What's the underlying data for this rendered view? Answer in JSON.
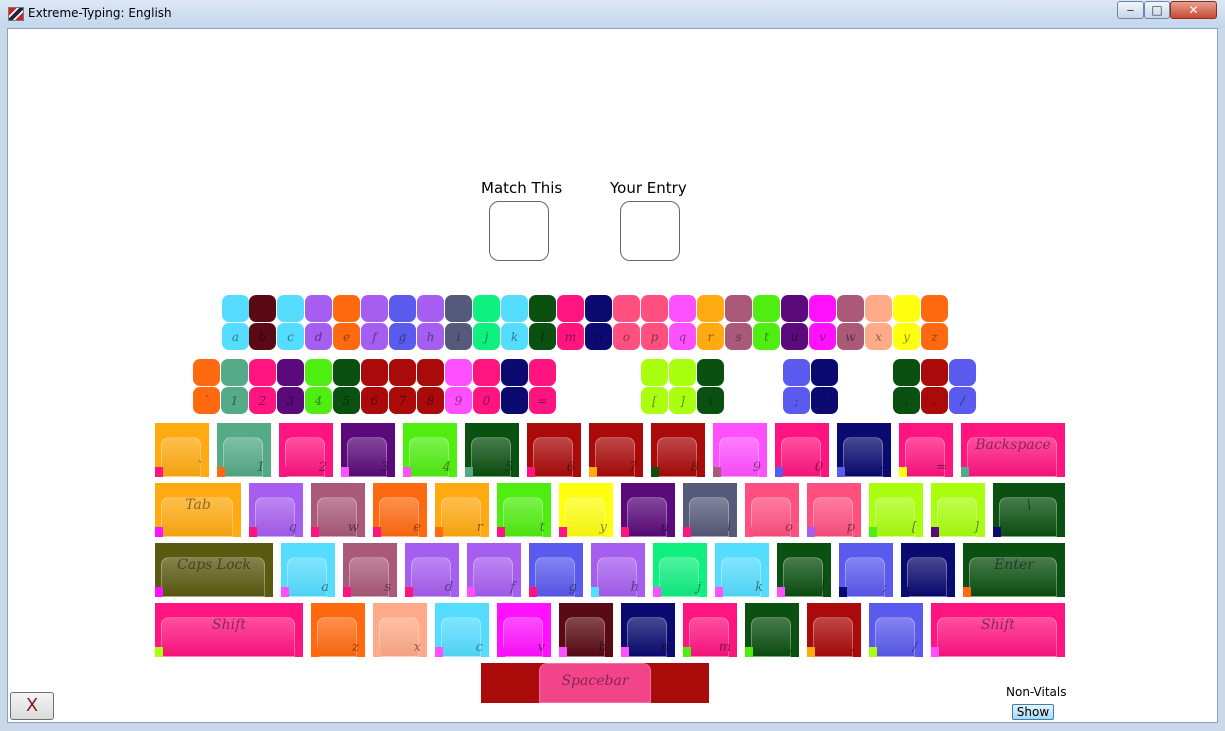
{
  "window": {
    "title": "Extreme-Typing: English",
    "minimize": "‒",
    "maximize": "□",
    "close": "✕"
  },
  "prompts": {
    "match_label": "Match This",
    "entry_label": "Your Entry"
  },
  "small_rows": [
    {
      "keys": [
        {
          "top": "#55ddff",
          "bottom": "#55ddff",
          "label": "a"
        },
        {
          "top": "#5a0a14",
          "bottom": "#5a0a14",
          "label": "b"
        },
        {
          "top": "#55ddff",
          "bottom": "#55ddff",
          "label": "c"
        },
        {
          "top": "#a65ef0",
          "bottom": "#a65ef0",
          "label": "d"
        },
        {
          "top": "#ff6a10",
          "bottom": "#ff6a10",
          "label": "e"
        },
        {
          "top": "#a65ef0",
          "bottom": "#a65ef0",
          "label": "f"
        },
        {
          "top": "#5a5aee",
          "bottom": "#5a5aee",
          "label": "g"
        },
        {
          "top": "#a65ef0",
          "bottom": "#a65ef0",
          "label": "h"
        },
        {
          "top": "#555a7a",
          "bottom": "#555a7a",
          "label": "i"
        },
        {
          "top": "#10f080",
          "bottom": "#10f080",
          "label": "j"
        },
        {
          "top": "#55ddff",
          "bottom": "#55ddff",
          "label": "k"
        },
        {
          "top": "#0a5010",
          "bottom": "#0a5010",
          "label": "l"
        },
        {
          "top": "#ff1480",
          "bottom": "#ff1480",
          "label": "m"
        },
        {
          "top": "#0a0a70",
          "bottom": "#0a0a70",
          "label": "n"
        },
        {
          "top": "#ff5080",
          "bottom": "#ff5080",
          "label": "o"
        },
        {
          "top": "#ff5080",
          "bottom": "#ff5080",
          "label": "p"
        },
        {
          "top": "#ff50ff",
          "bottom": "#ff50ff",
          "label": "q"
        },
        {
          "top": "#ffaa10",
          "bottom": "#ffaa10",
          "label": "r"
        },
        {
          "top": "#aa5a78",
          "bottom": "#aa5a78",
          "label": "s"
        },
        {
          "top": "#50ee10",
          "bottom": "#50ee10",
          "label": "t"
        },
        {
          "top": "#5a0a7a",
          "bottom": "#5a0a7a",
          "label": "u"
        },
        {
          "top": "#ff10ff",
          "bottom": "#ff10ff",
          "label": "v"
        },
        {
          "top": "#aa5a78",
          "bottom": "#aa5a78",
          "label": "w"
        },
        {
          "top": "#ffaa88",
          "bottom": "#ffaa88",
          "label": "x"
        },
        {
          "top": "#ffff10",
          "bottom": "#ffff10",
          "label": "y"
        },
        {
          "top": "#ff6a10",
          "bottom": "#ff6a10",
          "label": "z"
        }
      ]
    },
    {
      "keys": [
        {
          "top": "#ff6a10",
          "bottom": "#ff6a10",
          "label": "`"
        },
        {
          "top": "#55aa88",
          "bottom": "#55aa88",
          "label": "1"
        },
        {
          "top": "#ff1480",
          "bottom": "#ff1480",
          "label": "2"
        },
        {
          "top": "#5a0a7a",
          "bottom": "#5a0a7a",
          "label": "3"
        },
        {
          "top": "#50ee10",
          "bottom": "#50ee10",
          "label": "4"
        },
        {
          "top": "#0a5010",
          "bottom": "#0a5010",
          "label": "5"
        },
        {
          "top": "#aa0a0a",
          "bottom": "#aa0a0a",
          "label": "6"
        },
        {
          "top": "#aa0a0a",
          "bottom": "#aa0a0a",
          "label": "7"
        },
        {
          "top": "#aa0a0a",
          "bottom": "#aa0a0a",
          "label": "8"
        },
        {
          "top": "#ff50ff",
          "bottom": "#ff50ff",
          "label": "9"
        },
        {
          "top": "#ff1480",
          "bottom": "#ff1480",
          "label": "0"
        },
        {
          "top": "#0a0a70",
          "bottom": "#0a0a70",
          "label": "-"
        },
        {
          "top": "#ff1480",
          "bottom": "#ff1480",
          "label": "="
        },
        {
          "top": "#aaff10",
          "bottom": "#aaff10",
          "label": "["
        },
        {
          "top": "#aaff10",
          "bottom": "#aaff10",
          "label": "]"
        },
        {
          "top": "#0a5010",
          "bottom": "#0a5010",
          "label": "\\"
        },
        {
          "top": "#5a5aee",
          "bottom": "#5a5aee",
          "label": ";"
        },
        {
          "top": "#0a0a70",
          "bottom": "#0a0a70",
          "label": "'"
        },
        {
          "top": "#0a5010",
          "bottom": "#0a5010",
          "label": ","
        },
        {
          "top": "#aa0a0a",
          "bottom": "#aa0a0a",
          "label": "."
        },
        {
          "top": "#5a5aee",
          "bottom": "#5a5aee",
          "label": "/"
        }
      ]
    }
  ],
  "keyboard": [
    [
      {
        "color": "#ffaa10",
        "acc": "#ff1480",
        "label": "`"
      },
      {
        "color": "#55aa88",
        "acc": "#ff6a10",
        "label": "1"
      },
      {
        "color": "#ff1480",
        "acc": "#ff1480",
        "label": "2"
      },
      {
        "color": "#5a0a7a",
        "acc": "#ff50ff",
        "label": "3"
      },
      {
        "color": "#50ee10",
        "acc": "#ff50ff",
        "label": "4"
      },
      {
        "color": "#0a5010",
        "acc": "#55aa88",
        "label": "5"
      },
      {
        "color": "#aa0a0a",
        "acc": "#ff1480",
        "label": "6"
      },
      {
        "color": "#aa0a0a",
        "acc": "#ffaa10",
        "label": "7"
      },
      {
        "color": "#aa0a0a",
        "acc": "#0a5010",
        "label": "8"
      },
      {
        "color": "#ff50ff",
        "acc": "#aa5a78",
        "label": "9"
      },
      {
        "color": "#ff1480",
        "acc": "#5a5aee",
        "label": "0"
      },
      {
        "color": "#0a0a70",
        "acc": "#5a5aee",
        "label": "-"
      },
      {
        "color": "#ff1480",
        "acc": "#ffff10",
        "label": "="
      },
      {
        "color": "#ff1480",
        "acc": "#55aa88",
        "label": "Backspace",
        "wide": true
      }
    ],
    [
      {
        "color": "#ffaa10",
        "acc": "#ff10ff",
        "label": "Tab",
        "wide": true
      },
      {
        "color": "#a65ef0",
        "acc": "#ff1480",
        "label": "q"
      },
      {
        "color": "#aa5a78",
        "acc": "#ff1480",
        "label": "w"
      },
      {
        "color": "#ff6a10",
        "acc": "#ff1480",
        "label": "e"
      },
      {
        "color": "#ffaa10",
        "acc": "#ff6a10",
        "label": "r"
      },
      {
        "color": "#50ee10",
        "acc": "#ff1480",
        "label": "t"
      },
      {
        "color": "#ffff10",
        "acc": "#ff1480",
        "label": "y"
      },
      {
        "color": "#5a0a7a",
        "acc": "#ff1480",
        "label": "u"
      },
      {
        "color": "#555a7a",
        "acc": "#ff1480",
        "label": "i"
      },
      {
        "color": "#ff5080",
        "acc": "#ff5080",
        "label": "o"
      },
      {
        "color": "#ff5080",
        "acc": "#a65ef0",
        "label": "p"
      },
      {
        "color": "#aaff10",
        "acc": "#50ee10",
        "label": "["
      },
      {
        "color": "#aaff10",
        "acc": "#5a0a7a",
        "label": "]"
      },
      {
        "color": "#0a5010",
        "acc": "#0a0a70",
        "label": "\\",
        "wide": true
      }
    ],
    [
      {
        "color": "#5a5a10",
        "acc": "#ff10ff",
        "label": "Caps Lock",
        "wide": true
      },
      {
        "color": "#55ddff",
        "acc": "#ff50ff",
        "label": "a"
      },
      {
        "color": "#aa5a78",
        "acc": "#ff1480",
        "label": "s"
      },
      {
        "color": "#a65ef0",
        "acc": "#ff1480",
        "label": "d"
      },
      {
        "color": "#a65ef0",
        "acc": "#ff50ff",
        "label": "f"
      },
      {
        "color": "#5a5aee",
        "acc": "#ff1480",
        "label": "g"
      },
      {
        "color": "#a65ef0",
        "acc": "#55ddff",
        "label": "h"
      },
      {
        "color": "#10f080",
        "acc": "#ff50ff",
        "label": "j"
      },
      {
        "color": "#55ddff",
        "acc": "#ff50ff",
        "label": "k"
      },
      {
        "color": "#0a5010",
        "acc": "#ff50ff",
        "label": "l"
      },
      {
        "color": "#5a5aee",
        "acc": "#0a0a70",
        "label": ";"
      },
      {
        "color": "#0a0a70",
        "acc": "#0a0a70",
        "label": "'"
      },
      {
        "color": "#0a5010",
        "acc": "#ff6a10",
        "label": "Enter",
        "wide": true
      }
    ],
    [
      {
        "color": "#ff1480",
        "acc": "#aaff10",
        "label": "Shift",
        "wide": true
      },
      {
        "color": "#ff6a10",
        "acc": "#ff6a10",
        "label": "z"
      },
      {
        "color": "#ffaa88",
        "acc": "#ffaa88",
        "label": "x"
      },
      {
        "color": "#55ddff",
        "acc": "#ff50ff",
        "label": "c"
      },
      {
        "color": "#ff10ff",
        "acc": "#ff10ff",
        "label": "v"
      },
      {
        "color": "#5a0a14",
        "acc": "#ff50ff",
        "label": "b"
      },
      {
        "color": "#0a0a70",
        "acc": "#ff50ff",
        "label": "n"
      },
      {
        "color": "#ff1480",
        "acc": "#50ee10",
        "label": "m"
      },
      {
        "color": "#0a5010",
        "acc": "#50ee10",
        "label": ","
      },
      {
        "color": "#aa0a0a",
        "acc": "#ffaa10",
        "label": "."
      },
      {
        "color": "#5a5aee",
        "acc": "#aaff10",
        "label": "/"
      },
      {
        "color": "#ff1480",
        "acc": "#ff50ff",
        "label": "Shift",
        "wide": true
      }
    ]
  ],
  "spacebar": {
    "label": "Spacebar",
    "color": "#aa0a0a",
    "acc": "#ff50a0"
  },
  "exit_button": {
    "label": "X"
  },
  "non_vitals": {
    "label": "Non-Vitals",
    "button": "Show"
  }
}
